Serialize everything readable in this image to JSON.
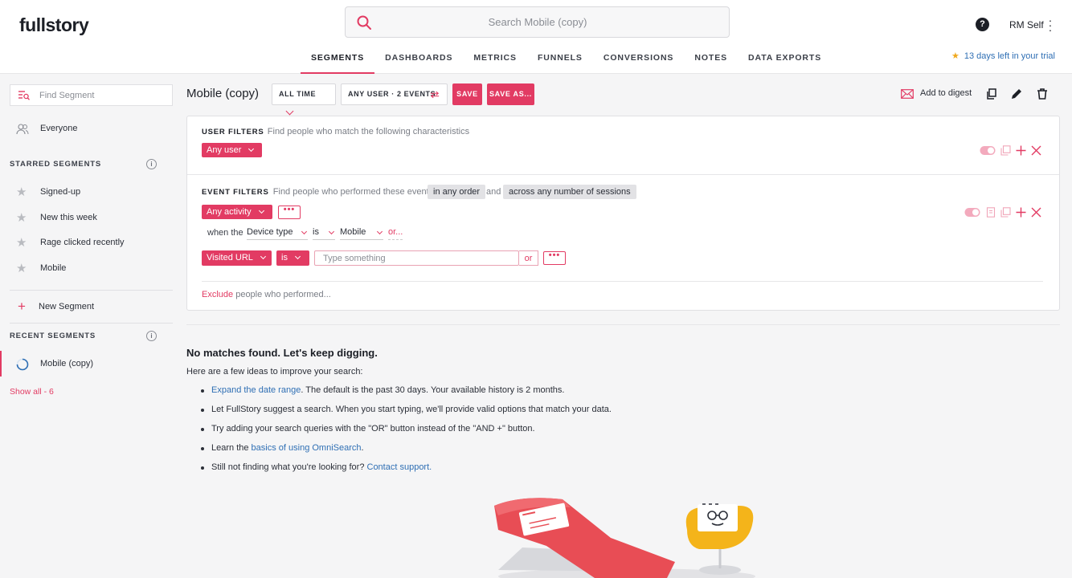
{
  "app": {
    "logo": "fullstory"
  },
  "search": {
    "placeholder": "Search Mobile (copy)"
  },
  "user": {
    "help": "?",
    "name": "RM Self"
  },
  "nav": {
    "tabs": [
      "SEGMENTS",
      "DASHBOARDS",
      "METRICS",
      "FUNNELS",
      "CONVERSIONS",
      "NOTES",
      "DATA EXPORTS"
    ],
    "active": "SEGMENTS"
  },
  "trial": {
    "text": "13 days left in your trial",
    "star_color": "#f0a81c"
  },
  "sidebar": {
    "find_placeholder": "Find Segment",
    "everyone": "Everyone",
    "starred_header": "STARRED SEGMENTS",
    "starred": [
      "Signed-up",
      "New this week",
      "Rage clicked recently",
      "Mobile"
    ],
    "new_segment": "New Segment",
    "recent_header": "RECENT SEGMENTS",
    "recent": [
      "Mobile (copy)"
    ],
    "show_all": "Show all - 6"
  },
  "toolbar": {
    "title": "Mobile (copy)",
    "time_range": "ALL TIME",
    "user_events": "ANY USER · 2 EVENTS",
    "save": "SAVE",
    "save_as": "SAVE AS...",
    "add_to_digest": "Add to digest"
  },
  "filters": {
    "user_header": "USER FILTERS",
    "user_desc": "Find people who match the following characteristics",
    "any_user": "Any user",
    "event_header": "EVENT FILTERS",
    "event_desc": "Find people who performed these events",
    "order": "in any order",
    "and": "and",
    "sessions": "across any number of sessions",
    "any_activity": "Any activity",
    "more": "•••",
    "when_the": "when the",
    "property": "Device type",
    "operator": "is",
    "value": "Mobile",
    "or_link": "or...",
    "visited_url": "Visited URL",
    "url_operator": "is",
    "url_placeholder": "Type something",
    "or_button": "or",
    "exclude": "Exclude",
    "exclude_rest": "people who performed..."
  },
  "empty_state": {
    "title": "No matches found. Let's keep digging.",
    "subtitle": "Here are a few ideas to improve your search:",
    "tip1_link": "Expand the date range",
    "tip1_rest": ". The default is the past 30 days. Your available history is 2 months.",
    "tip2": "Let FullStory suggest a search. When you start typing, we'll provide valid options that match your data.",
    "tip3": "Try adding your search queries with the \"OR\" button instead of the \"AND +\" button.",
    "tip4_pre": "Learn the ",
    "tip4_link": "basics of using OmniSearch",
    "tip4_post": ".",
    "tip5_pre": "Still not finding what you're looking for? ",
    "tip5_link": "Contact support."
  },
  "colors": {
    "accent": "#e23b63",
    "link": "#2f6fb4"
  }
}
